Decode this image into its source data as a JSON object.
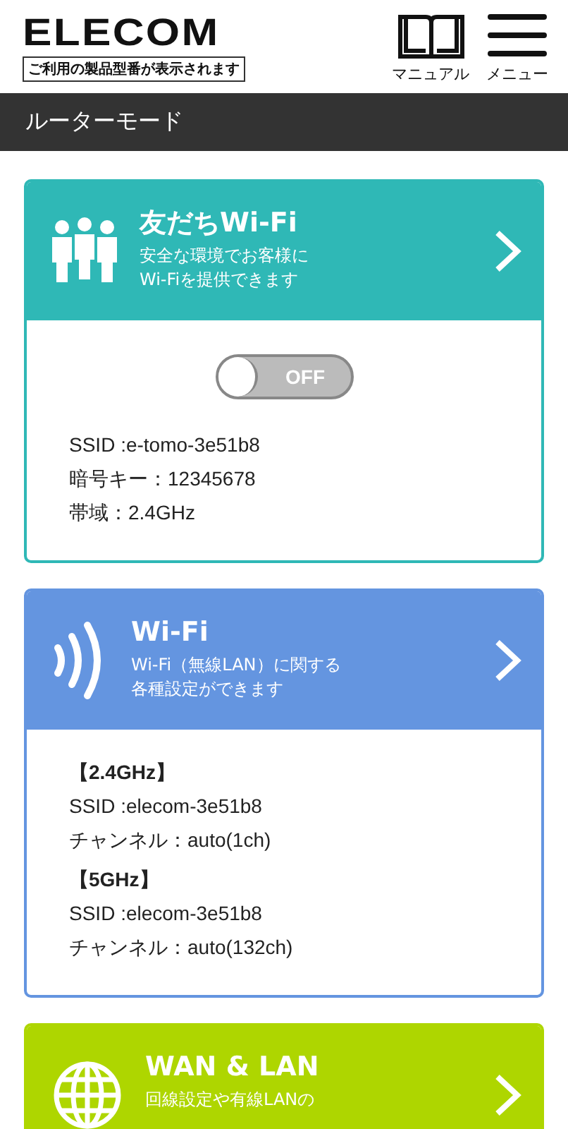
{
  "header": {
    "logo": "ELECOM",
    "model_note": "ご利用の製品型番が表示されます",
    "manual": "マニュアル",
    "menu": "メニュー"
  },
  "mode_bar": {
    "title": "ルーターモード"
  },
  "cards": [
    {
      "kind": "friends",
      "color": "#2fb8b6",
      "title": "友だちWi-Fi",
      "description": [
        "安全な環境でお客様に",
        "Wi-Fiを提供できます"
      ],
      "toggle": {
        "on": false,
        "label": "OFF"
      },
      "lines": [
        {
          "kind": "line",
          "text": "SSID :e-tomo-3e51b8"
        },
        {
          "kind": "line",
          "text": "暗号キー：12345678"
        },
        {
          "kind": "line",
          "text": "帯域：2.4GHz"
        }
      ]
    },
    {
      "kind": "wifi",
      "color": "#6495e0",
      "title": "Wi-Fi",
      "description": [
        "Wi-Fi（無線LAN）に関する",
        "各種設定ができます"
      ],
      "lines": [
        {
          "kind": "heading",
          "text": "【2.4GHz】"
        },
        {
          "kind": "line",
          "text": "SSID :elecom-3e51b8"
        },
        {
          "kind": "line",
          "text": "チャンネル：auto(1ch)"
        },
        {
          "kind": "heading",
          "text": "【5GHz】"
        },
        {
          "kind": "line",
          "text": "SSID :elecom-3e51b8"
        },
        {
          "kind": "line",
          "text": "チャンネル：auto(132ch)"
        }
      ]
    },
    {
      "kind": "globe",
      "color": "#aed600",
      "title": "WAN & LAN",
      "description": [
        "回線設定や有線LANの"
      ]
    }
  ]
}
